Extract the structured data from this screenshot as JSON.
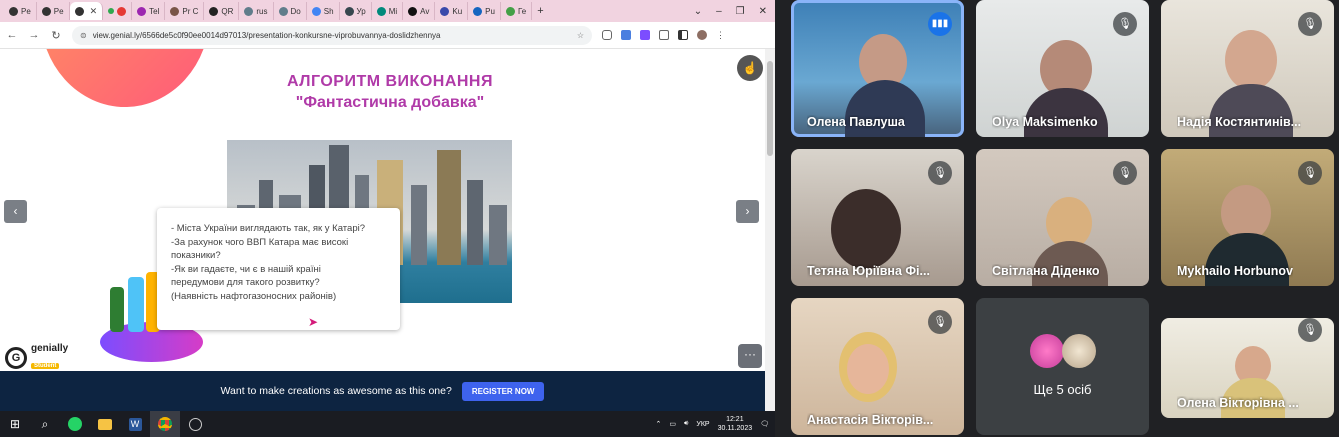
{
  "browser": {
    "tabs": [
      {
        "label": "Pe",
        "icon": "google-icon",
        "active": false
      },
      {
        "label": "Pe",
        "icon": "google-icon",
        "active": false
      },
      {
        "label": "",
        "icon": "google-icon",
        "active": true
      },
      {
        "label": "",
        "icon": "record-icon",
        "active": false
      },
      {
        "label": "Tel",
        "icon": "page-icon",
        "active": false
      },
      {
        "label": "Pr C",
        "icon": "page-icon",
        "active": false
      },
      {
        "label": "QR",
        "icon": "page-icon",
        "active": false
      },
      {
        "label": "rus",
        "icon": "page-icon",
        "active": false
      },
      {
        "label": "Do",
        "icon": "page-icon",
        "active": false
      },
      {
        "label": "Sh",
        "icon": "google-icon",
        "active": false
      },
      {
        "label": "Ур",
        "icon": "page-icon",
        "active": false
      },
      {
        "label": "Mi",
        "icon": "page-icon",
        "active": false
      },
      {
        "label": "Av",
        "icon": "page-icon",
        "active": false
      },
      {
        "label": "Ku",
        "icon": "page-icon",
        "active": false
      },
      {
        "label": "Pu",
        "icon": "page-icon",
        "active": false
      },
      {
        "label": "Ге",
        "icon": "page-icon",
        "active": false
      }
    ],
    "new_tab": "+",
    "url": "view.genial.ly/6566de5c0f90ee0014d97013/presentation-konkursne-viprobuvannya-doslidzhennya"
  },
  "slide": {
    "title_line1": "АЛГОРИТМ ВИКОНАННЯ",
    "title_line2": "\"Фантастична добавка\"",
    "bubble_lines": [
      "- Міста України виглядають так, як у Катарі?",
      "-За рахунок чого ВВП Катара має високі",
      "показники?",
      "-Як ви гадаєте, чи є в нашій країні",
      "передумови для такого розвитку?",
      "(Наявність нафтогазоносних районів)"
    ],
    "logo_text": "genially",
    "logo_badge": "Student",
    "prev": "‹",
    "next": "›",
    "more": "···"
  },
  "promo": {
    "text": "Want to make creations as awesome as this one?",
    "button": "REGISTER NOW"
  },
  "taskbar": {
    "lang": "УКР",
    "time": "12:21",
    "date": "30.11.2023"
  },
  "meet": {
    "participants": [
      {
        "name": "Олена Павлуша",
        "speaking": true
      },
      {
        "name": "Olya Maksimenko",
        "speaking": false
      },
      {
        "name": "Надія Костянтинів...",
        "speaking": false
      },
      {
        "name": "Тетяна Юріївна Фі...",
        "speaking": false
      },
      {
        "name": "Світлана Діденко",
        "speaking": false
      },
      {
        "name": "Mykhailo Horbunov",
        "speaking": false
      },
      {
        "name": "Анастасія Вікторів...",
        "speaking": false
      },
      {
        "name": "Олена Вікторівна ...",
        "speaking": false
      }
    ],
    "more_label": "Ще 5 осіб"
  },
  "colors": {
    "accent_title": "#b03aa8",
    "promo_bg": "#0d2441",
    "promo_button": "#3e63ee",
    "meet_bg": "#202124",
    "speaking_border": "#8ab4f8"
  }
}
